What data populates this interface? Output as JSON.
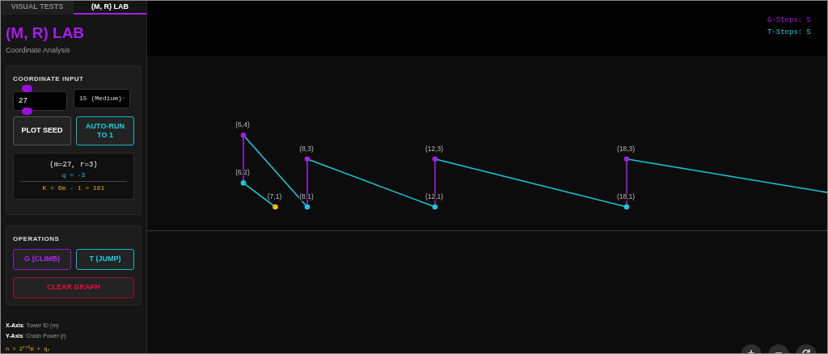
{
  "tabs": [
    {
      "label": "VISUAL TESTS",
      "selected": false
    },
    {
      "label": "(M, R) LAB",
      "selected": true
    }
  ],
  "title": "(M, R) LAB",
  "subtitle": "Coordinate Analysis",
  "coordinate_input": {
    "heading": "COORDINATE INPUT",
    "value": "27",
    "select": "15 (Medium)",
    "buttons": [
      {
        "label": "PLOT SEED",
        "kind": "plain"
      },
      {
        "label": "AUTO-RUN TO 1",
        "kind": "cyan"
      }
    ],
    "result": {
      "coords": "(m=27, r=3)",
      "q": "q = -3",
      "k": "K = 6m - 1 = 161"
    }
  },
  "operations": {
    "heading": "OPERATIONS",
    "buttons": [
      {
        "label": "G (CLIMB)",
        "kind": "magenta"
      },
      {
        "label": "T (JUMP)",
        "kind": "cyan"
      },
      {
        "label": "CLEAR GRAPH",
        "kind": "red"
      }
    ]
  },
  "legend": [
    {
      "text": "**X-Axis**: Tower ID (m)",
      "kind": "note"
    },
    {
      "text": "**Y-Axis**: Crash Power (r)",
      "kind": "note"
    },
    {
      "text": "n = 2$^{r+1}$m + q$_{r}$",
      "kind": "formula"
    }
  ],
  "counters": [
    {
      "text": "G-Steps: 5",
      "kind": "g"
    },
    {
      "text": "T-Steps: 5",
      "kind": "t"
    }
  ],
  "graph": {
    "points": [
      {
        "label": "(7,1)",
        "kind": "end",
        "linked": false,
        "continues": false
      },
      {
        "label": "(6,2)",
        "kind": "base",
        "linked": true,
        "continues": false
      },
      {
        "label": "(6,4)",
        "kind": "peak",
        "linked": true,
        "continues": false
      },
      {
        "label": "(8,1)",
        "kind": "base",
        "linked": true,
        "continues": false
      },
      {
        "label": "(8,3)",
        "kind": "peak",
        "linked": true,
        "continues": false
      },
      {
        "label": "(12,1)",
        "kind": "base",
        "linked": true,
        "continues": false
      },
      {
        "label": "(12,3)",
        "kind": "peak",
        "linked": true,
        "continues": false
      },
      {
        "label": "(18,1)",
        "kind": "base",
        "linked": true,
        "continues": false
      },
      {
        "label": "(18,3)",
        "kind": "peak",
        "linked": true,
        "continues": true
      }
    ]
  },
  "map_controls": [
    {
      "kind": "plus"
    },
    {
      "kind": "minus"
    },
    {
      "kind": "reset"
    }
  ]
}
